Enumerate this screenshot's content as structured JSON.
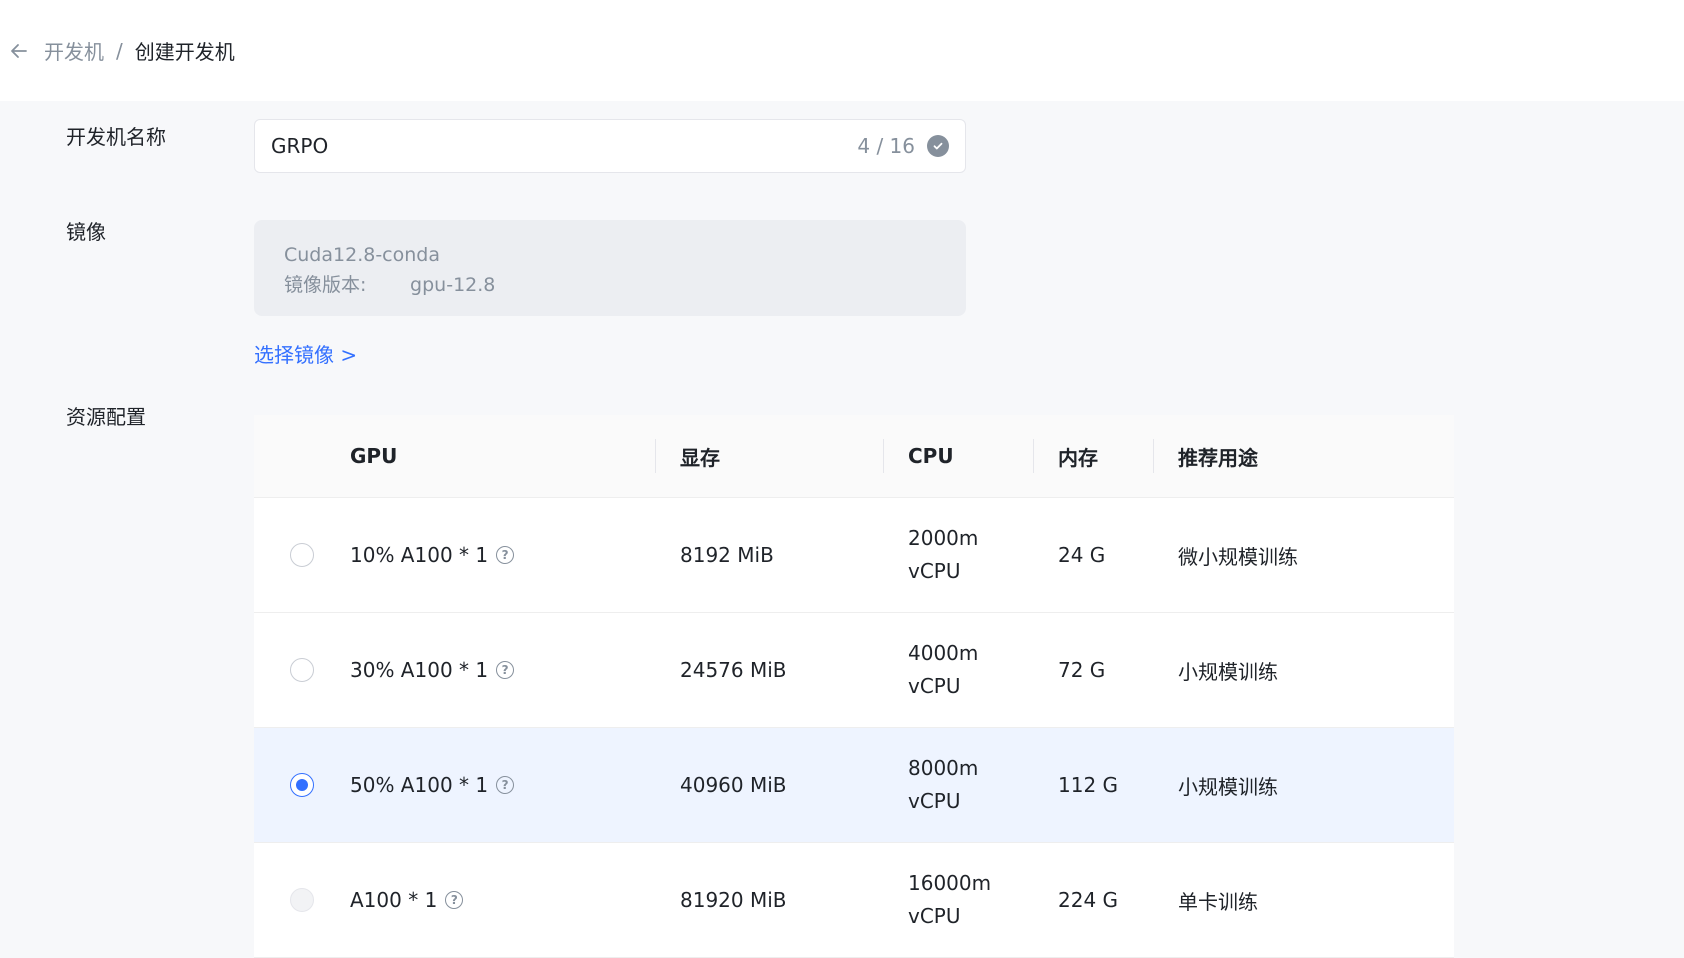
{
  "breadcrumb": {
    "parent": "开发机",
    "separator": "/",
    "current": "创建开发机"
  },
  "form": {
    "name": {
      "label": "开发机名称",
      "value": "GRPO",
      "counter": "4 / 16"
    },
    "image": {
      "label": "镜像",
      "name": "Cuda12.8-conda",
      "version_label": "镜像版本:",
      "version_value": "gpu-12.8",
      "select_link": "选择镜像 >"
    },
    "resources": {
      "label": "资源配置",
      "columns": [
        "GPU",
        "显存",
        "CPU",
        "内存",
        "推荐用途"
      ],
      "rows": [
        {
          "gpu": "10% A100 * 1",
          "vram": "8192 MiB",
          "cpu_line1": "2000m",
          "cpu_line2": "vCPU",
          "ram": "24 G",
          "use": "微小规模训练",
          "state": "unselected"
        },
        {
          "gpu": "30% A100 * 1",
          "vram": "24576 MiB",
          "cpu_line1": "4000m",
          "cpu_line2": "vCPU",
          "ram": "72 G",
          "use": "小规模训练",
          "state": "unselected"
        },
        {
          "gpu": "50% A100 * 1",
          "vram": "40960 MiB",
          "cpu_line1": "8000m",
          "cpu_line2": "vCPU",
          "ram": "112 G",
          "use": "小规模训练",
          "state": "selected"
        },
        {
          "gpu": "A100 * 1",
          "vram": "81920 MiB",
          "cpu_line1": "16000m",
          "cpu_line2": "vCPU",
          "ram": "224 G",
          "use": "单卡训练",
          "state": "disabled"
        }
      ]
    }
  },
  "icons": {
    "back": "arrow-left-icon",
    "check": "check-circle-icon",
    "help": "question-circle-icon"
  },
  "colors": {
    "accent": "#3370ff",
    "selected_row": "#eef4ff"
  }
}
